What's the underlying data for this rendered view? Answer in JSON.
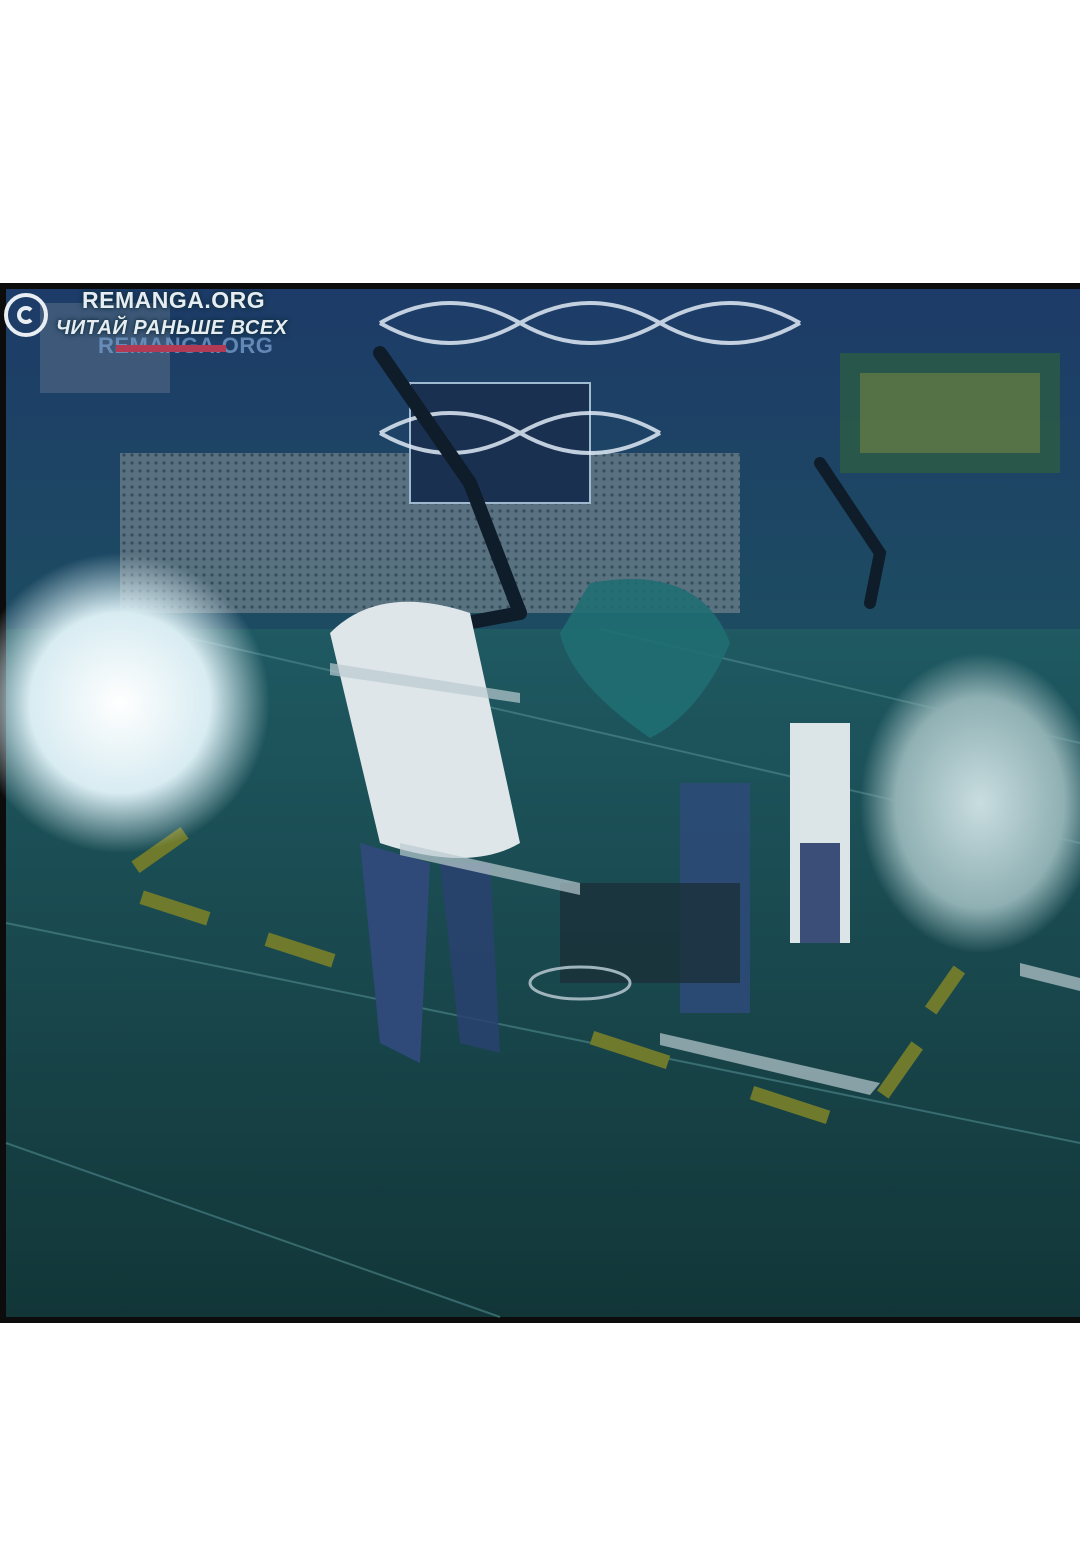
{
  "watermarks": {
    "left_text": "REMANGA.ORG",
    "right_title": "REMANGA.ORG",
    "right_subtitle": "ЧИТАЙ РАНЬШЕ ВСЕХ"
  },
  "colors": {
    "page_background": "#ffffff",
    "panel_border": "#0c0c0c",
    "wall": "#1c3c66",
    "floor": "#1b4a4e",
    "light": "#e9f1f4",
    "hazard_stripe": "#6f7a2c",
    "watermark_accent": "#b23a55"
  },
  "icons": [
    "remanga-logo-icon"
  ]
}
